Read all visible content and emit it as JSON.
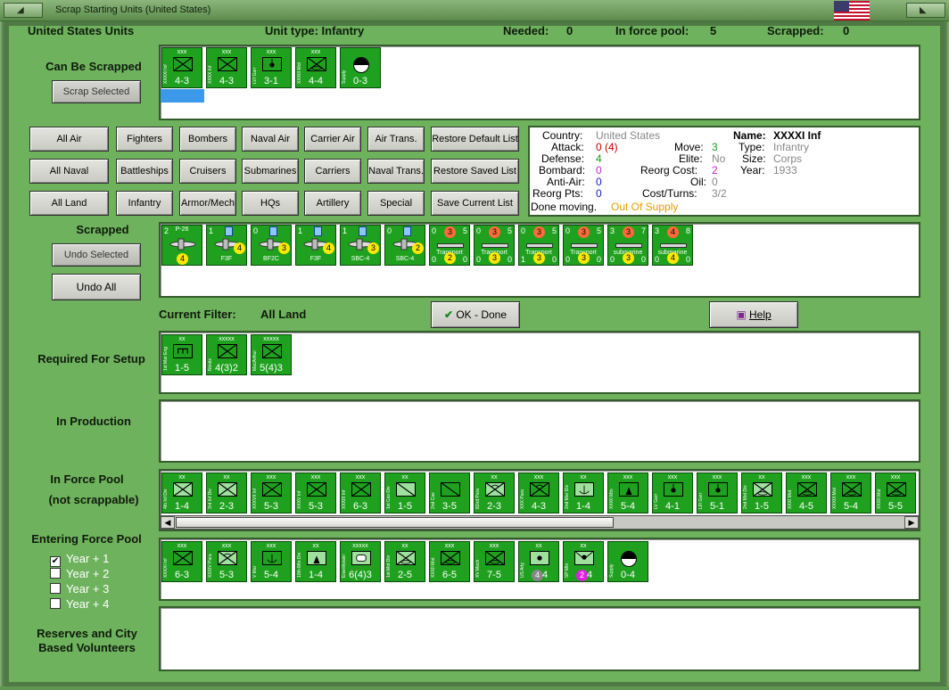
{
  "window": {
    "title": "Scrap Starting Units (United States)"
  },
  "header": {
    "country": "United States Units",
    "unit_type": "Unit type: Infantry",
    "needed_label": "Needed:",
    "needed": "0",
    "in_force_pool_label": "In force pool:",
    "in_force_pool": "5",
    "scrapped_label": "Scrapped:",
    "scrapped": "0"
  },
  "sections": {
    "can_be_scrapped": "Can Be Scrapped",
    "scrapped": "Scrapped",
    "current_filter_label": "Current Filter:",
    "current_filter": "All Land",
    "required": "Required For Setup",
    "in_production": "In Production",
    "in_force_pool_a": "In Force Pool",
    "in_force_pool_b": "(not scrappable)",
    "entering": "Entering Force Pool",
    "reserves_a": "Reserves and City",
    "reserves_b": "Based Volunteers"
  },
  "buttons": {
    "scrap_selected": "Scrap Selected",
    "undo_selected": "Undo Selected",
    "undo_all": "Undo All",
    "ok_done": "OK - Done",
    "help": "Help"
  },
  "filters": [
    [
      "All Air",
      "Fighters",
      "Bombers",
      "Naval Air",
      "Carrier Air",
      "Air Trans.",
      "Restore Default List"
    ],
    [
      "All Naval",
      "Battleships",
      "Cruisers",
      "Submarines",
      "Carriers",
      "Naval Trans.",
      "Restore Saved List"
    ],
    [
      "All Land",
      "Infantry",
      "Armor/Mech",
      "HQs",
      "Artillery",
      "Special",
      "Save Current List"
    ]
  ],
  "info": {
    "country_k": "Country:",
    "country_v": "United States",
    "attack_k": "Attack:",
    "attack_v": "0 (4)",
    "defense_k": "Defense:",
    "defense_v": "4",
    "bombard_k": "Bombard:",
    "bombard_v": "0",
    "antiair_k": "Anti-Air:",
    "antiair_v": "0",
    "reorgpts_k": "Reorg Pts:",
    "reorgpts_v": "0",
    "move_k": "Move:",
    "move_v": "3",
    "elite_k": "Elite:",
    "elite_v": "No",
    "reorgcost_k": "Reorg Cost:",
    "reorgcost_v": "2",
    "oil_k": "Oil:",
    "oil_v": "0",
    "costturns_k": "Cost/Turns:",
    "costturns_v": "3/2",
    "name_k": "Name:",
    "name_v": "XXXXI Inf",
    "type_k": "Type:",
    "type_v": "Infantry",
    "size_k": "Size:",
    "size_v": "Corps",
    "year_k": "Year:",
    "year_v": "1933",
    "done_k": "Done moving.",
    "done_v": "Out Of Supply"
  },
  "can_be_scrapped": [
    {
      "size": "xxx",
      "name": "XXXXI Inf",
      "stat": "4-3",
      "sym": "inf"
    },
    {
      "size": "xxx",
      "name": "XXXX Inf",
      "stat": "4-3",
      "sym": "inf"
    },
    {
      "size": "xxx",
      "name": "LVI Garr",
      "stat": "3-1",
      "sym": "garr"
    },
    {
      "size": "xxx",
      "name": "XXXIII Mot",
      "stat": "4-4",
      "sym": "mot"
    },
    {
      "size": "",
      "name": "Supply",
      "stat": "0-3",
      "sym": "supply"
    }
  ],
  "scrapped_air": [
    {
      "tl": "2",
      "tr": "",
      "name": "P-26",
      "circle": "4"
    },
    {
      "tl": "1",
      "tr": "",
      "name": "F3F",
      "circle": "4"
    },
    {
      "tl": "0",
      "tr": "",
      "name": "BF2C",
      "circle": "3"
    },
    {
      "tl": "1",
      "tr": "",
      "name": "F3F",
      "circle": "4"
    },
    {
      "tl": "1",
      "tr": "",
      "name": "SBC-4",
      "circle": "3"
    },
    {
      "tl": "0",
      "tr": "",
      "name": "SBC-4",
      "circle": "2"
    }
  ],
  "scrapped_naval": [
    {
      "tl": "0",
      "red": "3",
      "tr": "5",
      "name": "Transport",
      "bl": "0",
      "yel": "2",
      "br": "0"
    },
    {
      "tl": "0",
      "red": "3",
      "tr": "5",
      "name": "Transport",
      "bl": "0",
      "yel": "3",
      "br": "0"
    },
    {
      "tl": "0",
      "red": "3",
      "tr": "5",
      "name": "Transport",
      "bl": "1",
      "yel": "3",
      "br": "0"
    },
    {
      "tl": "0",
      "red": "3",
      "tr": "5",
      "name": "Transport",
      "bl": "0",
      "yel": "3",
      "br": "0"
    },
    {
      "tl": "3",
      "red": "3",
      "tr": "7",
      "name": "submarine",
      "bl": "0",
      "yel": "3",
      "br": "0"
    },
    {
      "tl": "3",
      "red": "4",
      "tr": "8",
      "name": "submarine",
      "bl": "0",
      "yel": "4",
      "br": "0"
    }
  ],
  "required": [
    {
      "size": "xx",
      "name": "1st Mar Eng",
      "stat": "1-5",
      "sym": "eng"
    },
    {
      "size": "xxxxx",
      "name": "Nimitz",
      "stat": "4(3)2",
      "sym": "inf"
    },
    {
      "size": "xxxxx",
      "name": "MacArthur",
      "stat": "5(4)3",
      "sym": "inf"
    }
  ],
  "force_pool": [
    {
      "size": "xx",
      "name": "4th Inf Div",
      "stat": "1-4",
      "sym": "inf",
      "light": true
    },
    {
      "size": "xx",
      "name": "3rd Inf Div",
      "stat": "2-3",
      "sym": "inf",
      "light": true
    },
    {
      "size": "xxx",
      "name": "XXXVII Inf",
      "stat": "5-3",
      "sym": "inf"
    },
    {
      "size": "xxx",
      "name": "XXXV Inf",
      "stat": "5-3",
      "sym": "inf"
    },
    {
      "size": "xxx",
      "name": "XXXIII Inf",
      "stat": "6-3",
      "sym": "inf"
    },
    {
      "size": "xx",
      "name": "1st Cav Div",
      "stat": "1-5",
      "sym": "cav",
      "light": true
    },
    {
      "size": "",
      "name": "2nd Cav",
      "stat": "3-5",
      "sym": "cav"
    },
    {
      "size": "xx",
      "name": "82nd Para",
      "stat": "2-3",
      "sym": "para",
      "light": true
    },
    {
      "size": "xxx",
      "name": "XXX Para",
      "stat": "4-3",
      "sym": "para"
    },
    {
      "size": "xx",
      "name": "2nd Mar Div",
      "stat": "1-4",
      "sym": "mar",
      "light": true
    },
    {
      "size": "xxx",
      "name": "XXXII Mtn",
      "stat": "5-4",
      "sym": "mtn"
    },
    {
      "size": "xxx",
      "name": "LV Garr",
      "stat": "4-1",
      "sym": "garr"
    },
    {
      "size": "xxx",
      "name": "LIII Garr",
      "stat": "5-1",
      "sym": "garr"
    },
    {
      "size": "xx",
      "name": "2nd Mot Div",
      "stat": "1-5",
      "sym": "mot",
      "light": true
    },
    {
      "size": "xxx",
      "name": "XXXI Mot",
      "stat": "4-5",
      "sym": "mot"
    },
    {
      "size": "xxx",
      "name": "XXXIII Mot",
      "stat": "5-4",
      "sym": "mot"
    },
    {
      "size": "xxx",
      "name": "XXXII Mot",
      "stat": "5-5",
      "sym": "mot"
    }
  ],
  "entering_checks": [
    "Year + 1",
    "Year + 2",
    "Year + 3",
    "Year + 4"
  ],
  "entering": [
    {
      "size": "xxx",
      "name": "XXXXI Inf",
      "stat": "6-3",
      "sym": "inf"
    },
    {
      "size": "xxx",
      "name": "XXXIV Para",
      "stat": "5-3",
      "sym": "para",
      "light": true
    },
    {
      "size": "xxx",
      "name": "V Mar",
      "stat": "5-4",
      "sym": "mar"
    },
    {
      "size": "xx",
      "name": "10th Mtn Div",
      "stat": "1-4",
      "sym": "mtn",
      "light": true
    },
    {
      "size": "xxxxx",
      "name": "Eisenhower",
      "stat": "6(4)3",
      "sym": "hq",
      "light": true
    },
    {
      "size": "xx",
      "name": "1st Mot Div",
      "stat": "2-5",
      "sym": "mot",
      "light": true
    },
    {
      "size": "xxx",
      "name": "XXXII Mot",
      "stat": "6-5",
      "sym": "mot"
    },
    {
      "size": "xxx",
      "name": "XV Mech",
      "stat": "7-5",
      "sym": "mech"
    },
    {
      "size": "xx",
      "name": "US Arty",
      "stat": "4",
      "sym": "arty",
      "light": true,
      "badge": "4",
      "badge_color": "#888"
    },
    {
      "size": "xx",
      "name": "SP Mtn",
      "stat": "4",
      "sym": "spart",
      "light": true,
      "badge": "2",
      "badge_color": "#e020e0"
    },
    {
      "size": "",
      "name": "Supply",
      "stat": "0-4",
      "sym": "supply"
    }
  ],
  "colors": {
    "frame": "#6fb25e",
    "counter": "#1fa11f",
    "selection": "#3c98e8",
    "attack": "#cc0000",
    "defense": "#1a9a1a",
    "bombard": "#cc22cc",
    "antiair": "#1a1acc",
    "out_of_supply": "#e89a00"
  }
}
